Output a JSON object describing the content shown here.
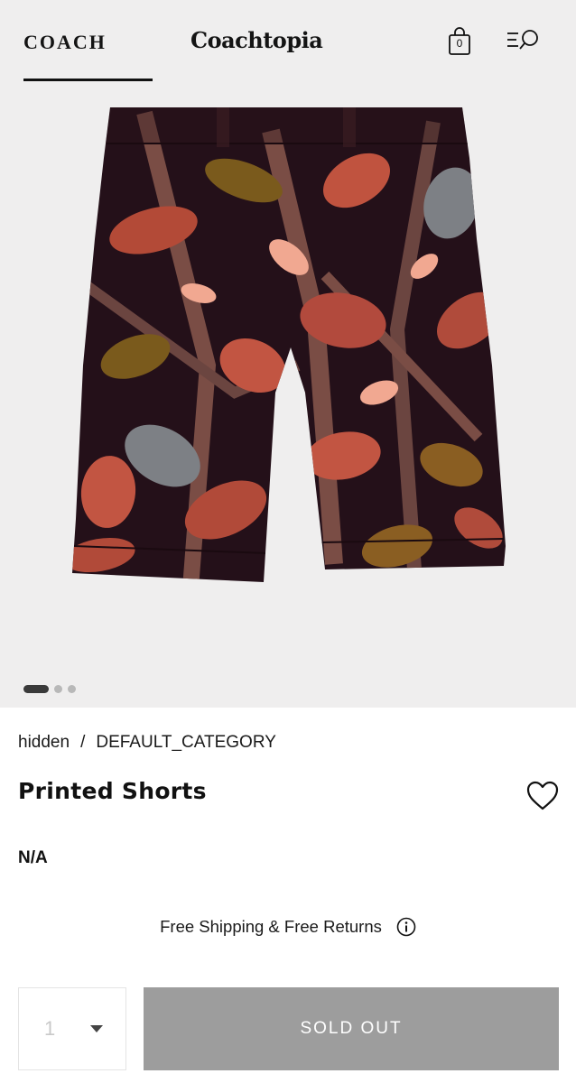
{
  "header": {
    "brand_logo": "COACH",
    "sub_brand": "Coachtopia",
    "bag_count": "0",
    "icons": [
      "shopping-bag-icon",
      "menu-search-icon"
    ]
  },
  "carousel": {
    "total_slides": 3,
    "active_index": 0
  },
  "breadcrumb": {
    "items": [
      "hidden",
      "DEFAULT_CATEGORY"
    ],
    "separator": "/"
  },
  "product": {
    "title": "Printed Shorts",
    "price": "N/A"
  },
  "shipping": {
    "text": "Free Shipping & Free Returns"
  },
  "purchase": {
    "quantity": "1",
    "sold_out_label": "SOLD OUT"
  },
  "colors": {
    "hero_background": "#efeeee",
    "button_disabled": "#9d9d9d",
    "text": "#111111"
  }
}
